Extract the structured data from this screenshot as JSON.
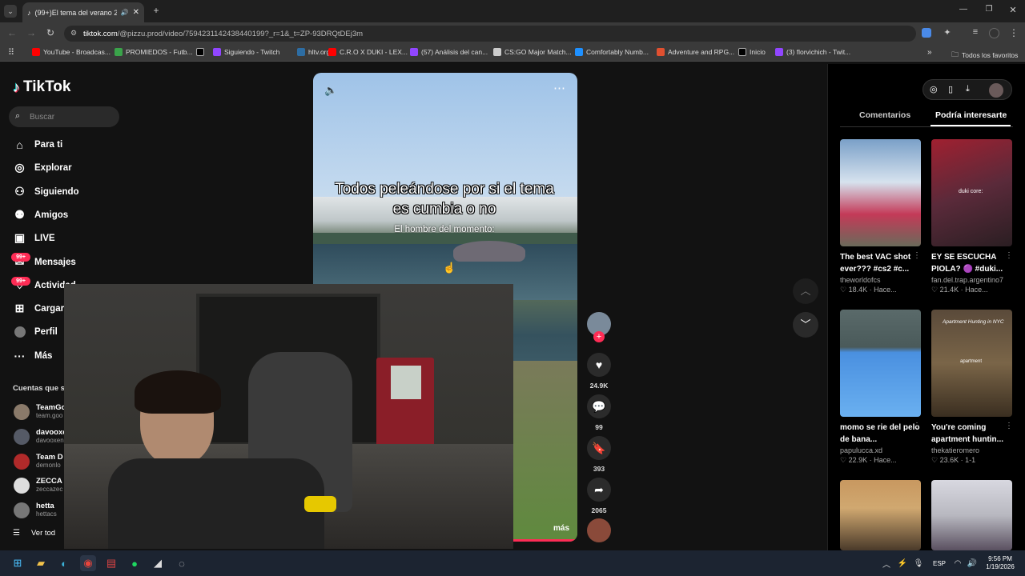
{
  "browser": {
    "tab_title": "(99+)El tema del verano 20...",
    "url_host": "tiktok.com",
    "url_path": "/@pizzu.prod/video/7594231142438440199?_r=1&_t=ZP-93DRQtDEj3m",
    "bookmarks": [
      {
        "label": "YouTube - Broadcas...",
        "color": "#ff0000"
      },
      {
        "label": "PROMIEDOS - Futb...",
        "color": "#3aa34a"
      },
      {
        "label": "",
        "color": "#000000"
      },
      {
        "label": "Siguiendo - Twitch",
        "color": "#9146ff"
      },
      {
        "label": "hltv.org",
        "color": "#2d6da3"
      },
      {
        "label": "C.R.O X DUKI - LEX...",
        "color": "#ff0000"
      },
      {
        "label": "(57) Análisis del can...",
        "color": "#9146ff"
      },
      {
        "label": "CS:GO Major Match...",
        "color": "#cccccc"
      },
      {
        "label": "Comfortably Numb...",
        "color": "#1e90ff"
      },
      {
        "label": "Adventure and RPG...",
        "color": "#e05030"
      },
      {
        "label": "Inicio",
        "color": "#000000"
      },
      {
        "label": "(3) florvichich - Twit...",
        "color": "#9146ff"
      }
    ],
    "all_bookmarks": "Todos los favoritos"
  },
  "tiktok": {
    "logo": "TikTok",
    "search_placeholder": "Buscar",
    "nav": [
      "Para ti",
      "Explorar",
      "Siguiendo",
      "Amigos",
      "LIVE",
      "Mensajes",
      "Actividad",
      "Cargar",
      "Perfil",
      "Más"
    ],
    "badges": [
      "99+",
      "99+"
    ],
    "following_title": "Cuentas que si",
    "accounts": [
      {
        "name": "TeamGo",
        "handle": "team.goo"
      },
      {
        "name": "davooxe",
        "handle": "davooxen"
      },
      {
        "name": "Team D",
        "handle": "demonlo"
      },
      {
        "name": "ZECCA",
        "handle": "zeccazec"
      },
      {
        "name": "hetta",
        "handle": "hettacs"
      }
    ],
    "see_all": "Ver tod"
  },
  "video": {
    "caption": "Todos peleándose por si el tema es cumbia o no",
    "subcaption": "El hombre del momento:",
    "more": "más",
    "likes": "24.9K",
    "comments": "99",
    "saves": "393",
    "shares": "2065"
  },
  "right_panel": {
    "tab_comments": "Comentarios",
    "tab_suggested": "Podría interesarte",
    "cards": [
      {
        "title": "The best VAC shot ever??? #cs2 #c...",
        "user": "theworldofcs",
        "likes": "18.4K",
        "time": "Hace...",
        "colors": [
          "#7aa0c8",
          "#c43a58"
        ]
      },
      {
        "title": "EY SE ESCUCHA PIOLA? 🟣 #duki...",
        "user": "fan.del.trap.argentino7",
        "likes": "21.4K",
        "time": "Hace...",
        "colors": [
          "#a02030",
          "#3a2a2a"
        ]
      },
      {
        "title": "momo se rie del pelo de bana...",
        "user": "papulucca.xd",
        "likes": "22.9K",
        "time": "Hace...",
        "colors": [
          "#5a6a7a",
          "#3a8ad8"
        ]
      },
      {
        "title": "You're coming apartment huntin...",
        "user": "thekatieromero",
        "likes": "23.6K",
        "time": "1-1",
        "colors": [
          "#6a5a40",
          "#2a2218"
        ]
      },
      {
        "title": "",
        "user": "",
        "likes": "",
        "time": "",
        "colors": [
          "#d0a870",
          "#4a3a2a"
        ]
      },
      {
        "title": "",
        "user": "",
        "likes": "",
        "time": "",
        "colors": [
          "#c8c8d0",
          "#5a5060"
        ]
      }
    ],
    "thumb_texts": [
      "duki core:",
      "Apartment Hunting in NYC",
      "apartment"
    ]
  },
  "taskbar": {
    "lang": "ESP",
    "time": "9:56 PM",
    "date": "1/19/2026"
  },
  "colors": {
    "accent": "#fe2c55"
  }
}
